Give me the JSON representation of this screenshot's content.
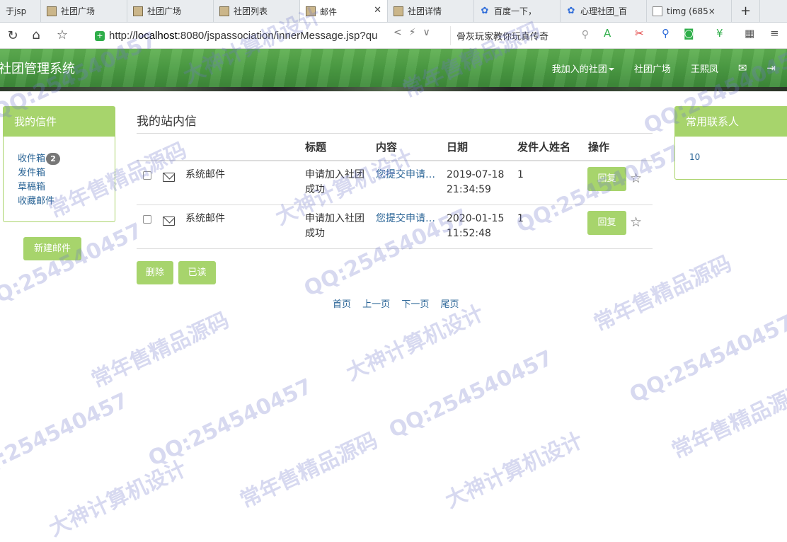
{
  "browser": {
    "tabs": [
      {
        "label": "于jsp",
        "icon": "picture-icon",
        "active": false,
        "width": 58
      },
      {
        "label": "社团广场",
        "icon": "picture-icon",
        "active": false,
        "width": 122
      },
      {
        "label": "社团广场",
        "icon": "picture-icon",
        "active": false,
        "width": 122
      },
      {
        "label": "社团列表",
        "icon": "picture-icon",
        "active": false,
        "width": 122
      },
      {
        "label": "邮件",
        "icon": "picture-icon",
        "active": true,
        "width": 124
      },
      {
        "label": "社团详情",
        "icon": "picture-icon",
        "active": false,
        "width": 122
      },
      {
        "label": "百度一下，",
        "icon": "paw-icon",
        "active": false,
        "width": 122
      },
      {
        "label": "心理社团_百",
        "icon": "paw-icon",
        "active": false,
        "width": 122
      },
      {
        "label": "timg (685×",
        "icon": "document-icon",
        "active": false,
        "width": 120
      }
    ],
    "url_prefix": "http://",
    "url_host": "localhost",
    "url_rest": ":8080/jspassociation/innerMessage.jsp?qu",
    "search_text": "骨灰玩家教你玩真传奇"
  },
  "header": {
    "brand": "社团管理系统",
    "nav": {
      "my_clubs": "我加入的社团",
      "square": "社团广场",
      "user": "王熙凤"
    }
  },
  "left_panel": {
    "title": "我的信件",
    "inbox": "收件箱",
    "inbox_count": "2",
    "sent": "发件箱",
    "drafts": "草稿箱",
    "favorites": "收藏邮件",
    "new_mail": "新建邮件"
  },
  "main": {
    "title": "我的站内信",
    "columns": {
      "title": "标题",
      "content": "内容",
      "date": "日期",
      "sender_name": "发件人姓名",
      "action": "操作"
    },
    "messages": [
      {
        "sender": "系统邮件",
        "title": "申请加入社团成功",
        "content": "您提交申请加入社团已通过",
        "date": "2019-07-18 21:34:59",
        "sender_name": "1",
        "reply": "回复"
      },
      {
        "sender": "系统邮件",
        "title": "申请加入社团成功",
        "content": "您提交申请加入社团已通过",
        "date": "2020-01-15 11:52:48",
        "sender_name": "1",
        "reply": "回复"
      }
    ],
    "delete_btn": "删除",
    "read_btn": "已读",
    "pager": {
      "first": "首页",
      "prev": "上一页",
      "next": "下一页",
      "last": "尾页"
    }
  },
  "right_panel": {
    "title": "常用联系人",
    "contact": "10"
  },
  "watermarks": [
    "QQ:254540457",
    "常年售精品源码",
    "大神计算机设计"
  ],
  "colors": {
    "accent": "#a7d46c",
    "header_green": "#4b9d43",
    "link": "#2a6496"
  }
}
